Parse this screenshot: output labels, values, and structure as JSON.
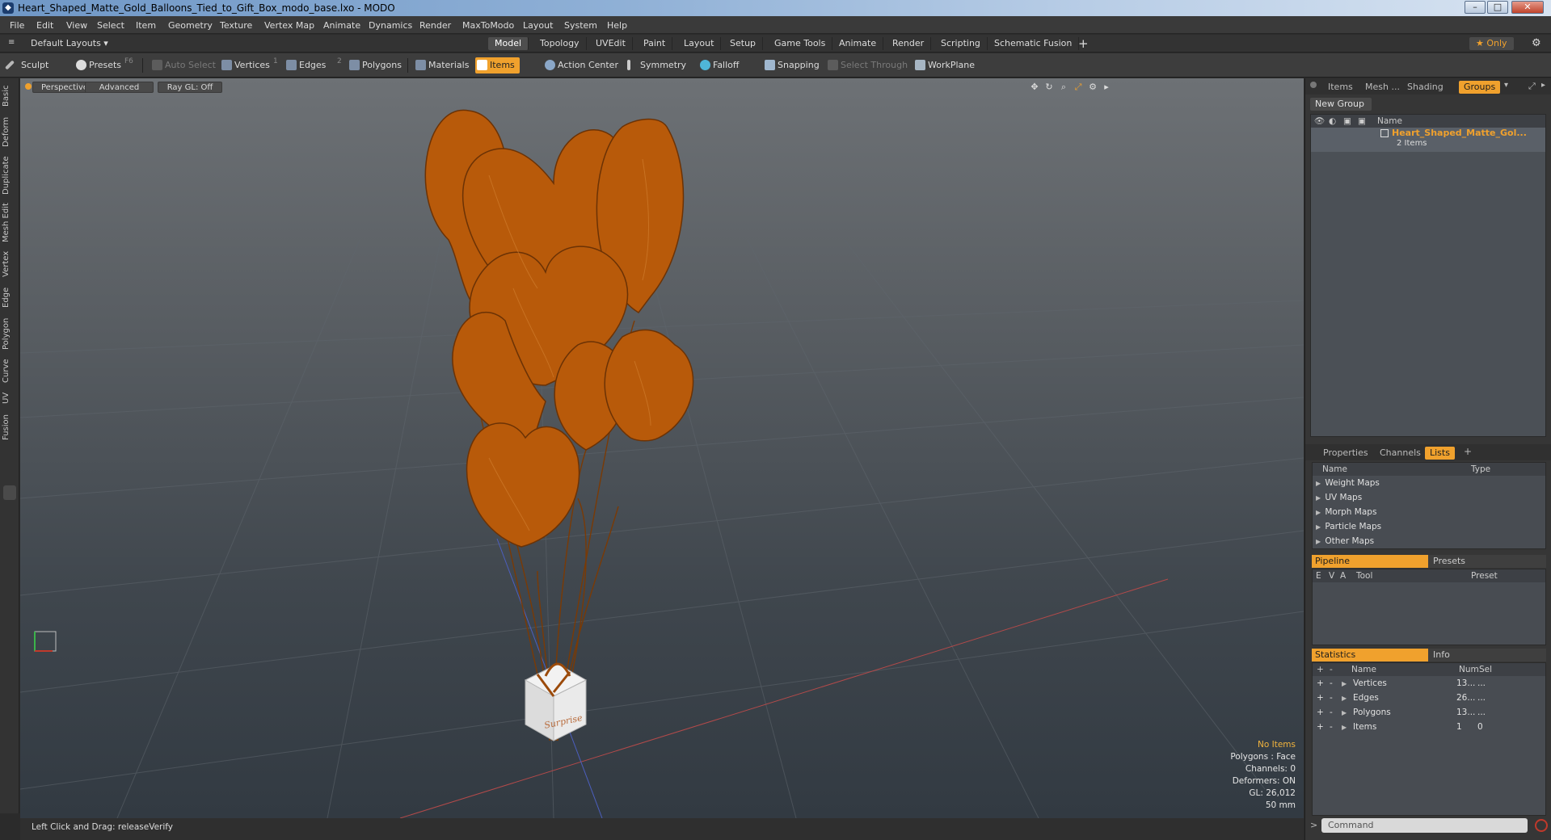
{
  "window": {
    "title": "Heart_Shaped_Matte_Gold_Balloons_Tied_to_Gift_Box_modo_base.lxo - MODO",
    "app_icon": "modo-icon",
    "controls": [
      "minimize",
      "maximize",
      "close"
    ]
  },
  "menu": [
    "File",
    "Edit",
    "View",
    "Select",
    "Item",
    "Geometry",
    "Texture",
    "Vertex Map",
    "Animate",
    "Dynamics",
    "Render",
    "MaxToModo",
    "Layout",
    "System",
    "Help"
  ],
  "layout_bar": {
    "layouts_label": "Default Layouts ▾",
    "tabs": [
      "Model",
      "Topology",
      "UVEdit",
      "Paint",
      "Layout",
      "Setup",
      "Game Tools",
      "Animate",
      "Render",
      "Scripting",
      "Schematic Fusion"
    ],
    "active_tab": "Model",
    "add_tab": "+",
    "only_label": "★  Only"
  },
  "toolbar": {
    "sculpt": "Sculpt",
    "presets": "Presets",
    "presets_key": "F6",
    "auto_select": "Auto Select",
    "vertices": "Vertices",
    "vertices_key": "1",
    "edges": "Edges",
    "edges_key": "2",
    "polygons": "Polygons",
    "materials": "Materials",
    "items": "Items",
    "action_center": "Action Center",
    "symmetry": "Symmetry",
    "falloff": "Falloff",
    "snapping": "Snapping",
    "select_through": "Select Through",
    "workplane": "WorkPlane"
  },
  "left_tabs": [
    "Basic",
    "Deform",
    "Duplicate",
    "Mesh Edit",
    "Vertex",
    "Edge",
    "Polygon",
    "Curve",
    "UV",
    "Fusion"
  ],
  "viewport": {
    "buttons": [
      "Perspective",
      "Advanced",
      "Ray GL: Off"
    ],
    "box_label": "Surprise",
    "stats": {
      "items": "No Items",
      "polygons": "Polygons : Face",
      "channels": "Channels: 0",
      "deformers": "Deformers: ON",
      "gl": "GL: 26,012",
      "lens": "50 mm"
    },
    "colors": {
      "balloon": "#b85a0a",
      "balloon_dark": "#7a3a05",
      "box": "#e8e8e8"
    }
  },
  "status_bar": {
    "text": "Left Click and Drag:   releaseVerify"
  },
  "right_panel": {
    "top_tabs": [
      "Items",
      "Mesh ...",
      "Shading",
      "Groups"
    ],
    "active_top_tab": "Groups",
    "new_group": "New Group",
    "groups_header": "Name",
    "group_item": {
      "name": "Heart_Shaped_Matte_Gol...",
      "count": "2 Items"
    },
    "mid_tabs": [
      "Properties",
      "Channels",
      "Lists"
    ],
    "active_mid_tab": "Lists",
    "lists_header": {
      "name": "Name",
      "type": "Type"
    },
    "lists": [
      "Weight Maps",
      "UV Maps",
      "Morph Maps",
      "Particle Maps",
      "Other Maps"
    ],
    "pipeline_tabs": [
      "Pipeline",
      "Presets"
    ],
    "pipeline_header": {
      "e": "E",
      "v": "V",
      "a": "A",
      "tool": "Tool",
      "preset": "Preset"
    },
    "stats_tabs": [
      "Statistics",
      "Info"
    ],
    "stats_header": {
      "name": "Name",
      "num": "Num",
      "sel": "Sel"
    },
    "stats_rows": [
      {
        "name": "Vertices",
        "num": "13...",
        "sel": "..."
      },
      {
        "name": "Edges",
        "num": "26...",
        "sel": "..."
      },
      {
        "name": "Polygons",
        "num": "13...",
        "sel": "..."
      },
      {
        "name": "Items",
        "num": "1",
        "sel": "0"
      }
    ],
    "command_placeholder": "Command"
  },
  "accent": "#f0a12d"
}
